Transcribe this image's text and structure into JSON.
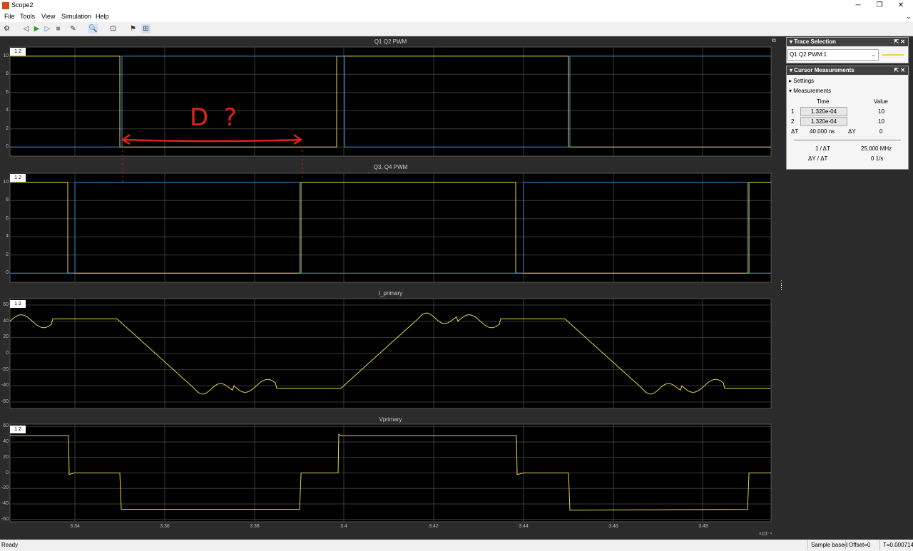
{
  "window": {
    "title": "Scope2",
    "minimize": "─",
    "restore": "❐",
    "close": "✕"
  },
  "menu": {
    "items": [
      "File",
      "Tools",
      "View",
      "Simulation",
      "Help"
    ]
  },
  "plots": [
    {
      "title": "Q1 Q2 PWM",
      "legend": "1  2",
      "yticks": [
        "10",
        "8",
        "6",
        "4",
        "2",
        "0"
      ]
    },
    {
      "title": "Q3, Q4 PWM",
      "legend": "1  2",
      "yticks": [
        "10",
        "8",
        "6",
        "4",
        "2",
        "0"
      ]
    },
    {
      "title": "I_primary",
      "legend": "1  2",
      "yticks": [
        "60",
        "40",
        "20",
        "0",
        "-20",
        "-40",
        "-60"
      ]
    },
    {
      "title": "Vprimary",
      "legend": "1  2",
      "yticks": [
        "60",
        "40",
        "20",
        "0",
        "-20",
        "-40",
        "-60"
      ]
    }
  ],
  "xaxis": {
    "ticks": [
      "3.34",
      "3.36",
      "3.38",
      "3.4",
      "3.42",
      "3.44",
      "3.46",
      "3.48"
    ],
    "exponent": "×10⁻⁴"
  },
  "annotation": {
    "text": "D  ?"
  },
  "trace_selection": {
    "title": "Trace Selection",
    "value": "Q1 Q2 PWM:1"
  },
  "cursor": {
    "title": "Cursor Measurements",
    "settings": "Settings",
    "measurements": "Measurements",
    "col_time": "Time",
    "col_value": "Value",
    "row1_label": "1",
    "row1_time": "1.320e-04",
    "row1_value": "10",
    "row2_label": "2",
    "row2_time": "1.320e-04",
    "row2_value": "10",
    "dt_label": "ΔT",
    "dt_value": "40.000 ns",
    "dy_label": "ΔY",
    "dy_value": "0",
    "inv_dt_label": "1 / ΔT",
    "inv_dt_value": "25.000 MHz",
    "dydt_label": "ΔY / ΔT",
    "dydt_value": "0 1/s"
  },
  "status": {
    "left": "Ready",
    "mode": "Sample based",
    "offset": "Offset=0",
    "time": "T=0.000714"
  },
  "colors": {
    "trace1": "#e6d84a",
    "trace2": "#2f8fd6",
    "grid": "#3a3a3a",
    "annotation": "#e0201a"
  }
}
